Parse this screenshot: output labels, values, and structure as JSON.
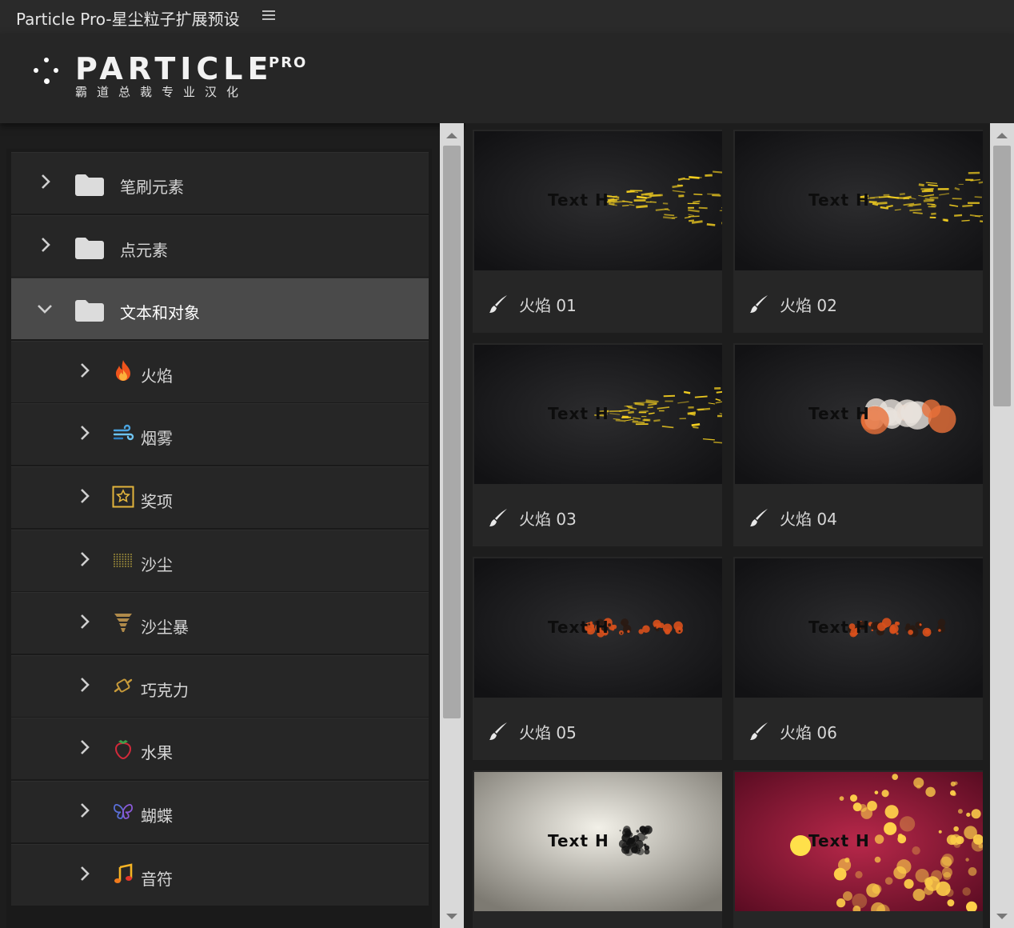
{
  "window": {
    "title": "Particle Pro-星尘粒子扩展预设"
  },
  "logo": {
    "main": "PARTICLE",
    "badge": "PRO",
    "subtitle": "霸道总裁专业汉化"
  },
  "tree": {
    "items": [
      {
        "label": "笔刷元素",
        "level": 0,
        "expanded": false,
        "icon": "folder-icon"
      },
      {
        "label": "点元素",
        "level": 0,
        "expanded": false,
        "icon": "folder-icon"
      },
      {
        "label": "文本和对象",
        "level": 0,
        "expanded": true,
        "selected": true,
        "icon": "folder-icon"
      },
      {
        "label": "火焰",
        "level": 1,
        "expanded": false,
        "icon": "flame-icon"
      },
      {
        "label": "烟雾",
        "level": 1,
        "expanded": false,
        "icon": "wind-icon"
      },
      {
        "label": "奖项",
        "level": 1,
        "expanded": false,
        "icon": "star-award-icon"
      },
      {
        "label": "沙尘",
        "level": 1,
        "expanded": false,
        "icon": "sand-dust-icon"
      },
      {
        "label": "沙尘暴",
        "level": 1,
        "expanded": false,
        "icon": "tornado-icon"
      },
      {
        "label": "巧克力",
        "level": 1,
        "expanded": false,
        "icon": "candy-icon"
      },
      {
        "label": "水果",
        "level": 1,
        "expanded": false,
        "icon": "strawberry-icon"
      },
      {
        "label": "蝴蝶",
        "level": 1,
        "expanded": false,
        "icon": "butterfly-icon"
      },
      {
        "label": "音符",
        "level": 1,
        "expanded": false,
        "icon": "music-note-icon"
      }
    ]
  },
  "presets": [
    {
      "label": "火焰 01",
      "thumb_text": "Text H",
      "style": "gold-spark"
    },
    {
      "label": "火焰 02",
      "thumb_text": "Text H",
      "style": "gold-spark"
    },
    {
      "label": "火焰 03",
      "thumb_text": "Text H",
      "style": "gold-spark"
    },
    {
      "label": "火焰 04",
      "thumb_text": "Text H",
      "style": "smoke-cloud"
    },
    {
      "label": "火焰 05",
      "thumb_text": "Text H",
      "style": "ember"
    },
    {
      "label": "火焰 06",
      "thumb_text": "Text H",
      "style": "ember"
    },
    {
      "label": "",
      "thumb_text": "Text H",
      "style": "ink-light"
    },
    {
      "label": "",
      "thumb_text": "Text H",
      "style": "bokeh-red"
    }
  ],
  "colors": {
    "panel": "#262626",
    "selected": "#4a4a4a",
    "scrollbar_track": "#d9d9d9",
    "scrollbar_thumb": "#a9a9a9",
    "spark": "#f5d020"
  }
}
